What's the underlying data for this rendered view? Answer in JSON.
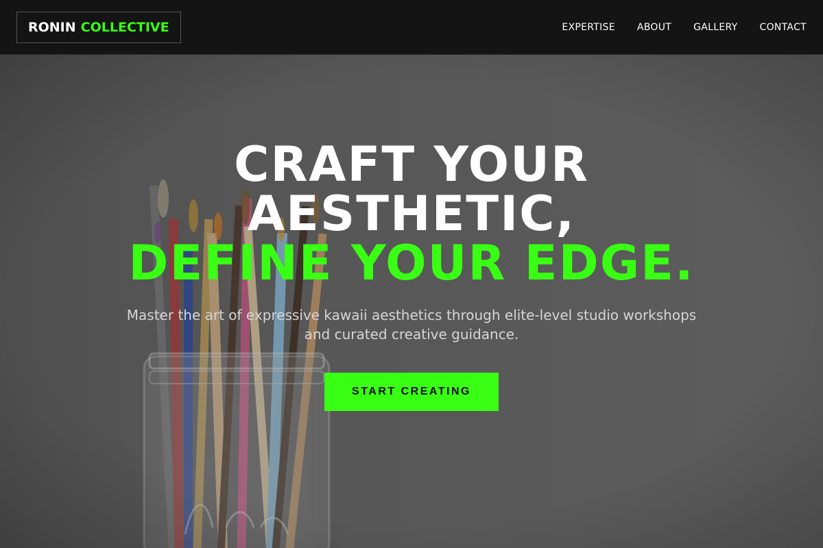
{
  "brand": {
    "name_white": "RONIN",
    "name_green": "COLLECTIVE"
  },
  "nav": {
    "items": [
      {
        "label": "EXPERTISE"
      },
      {
        "label": "ABOUT"
      },
      {
        "label": "GALLERY"
      },
      {
        "label": "CONTACT"
      }
    ]
  },
  "hero": {
    "headline_line1": "CRAFT YOUR",
    "headline_line2": "AESTHETIC,",
    "headline_line3": "DEFINE YOUR EDGE.",
    "subtitle": "Master the art of expressive kawaii aesthetics through elite-level studio workshops and curated creative guidance.",
    "cta_label": "START CREATING",
    "background_image": "paintbrushes-in-glass-jar"
  },
  "colors": {
    "accent": "#39ff14",
    "nav_bg": "#141414"
  }
}
